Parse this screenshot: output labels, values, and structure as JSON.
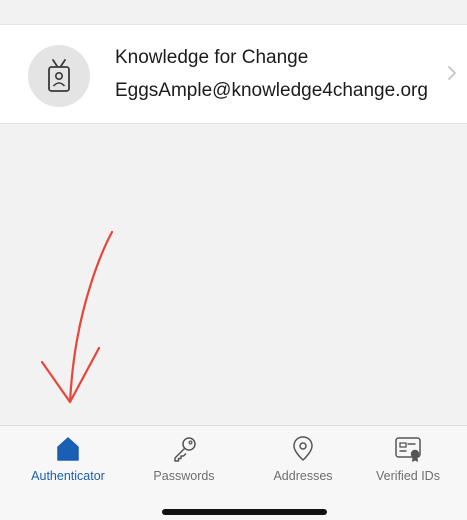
{
  "account": {
    "name": "Knowledge for Change",
    "email": "EggsAmple@knowledge4change.org",
    "avatar_icon": "id-badge-icon"
  },
  "tabs": [
    {
      "label": "Authenticator",
      "icon": "home-icon",
      "active": true
    },
    {
      "label": "Passwords",
      "icon": "key-icon",
      "active": false
    },
    {
      "label": "Addresses",
      "icon": "location-pin-icon",
      "active": false
    },
    {
      "label": "Verified IDs",
      "icon": "verified-id-card-icon",
      "active": false
    }
  ],
  "colors": {
    "accent": "#1a5fb4",
    "annotation_arrow": "#e8463a",
    "inactive_label": "#6e6e6e"
  }
}
